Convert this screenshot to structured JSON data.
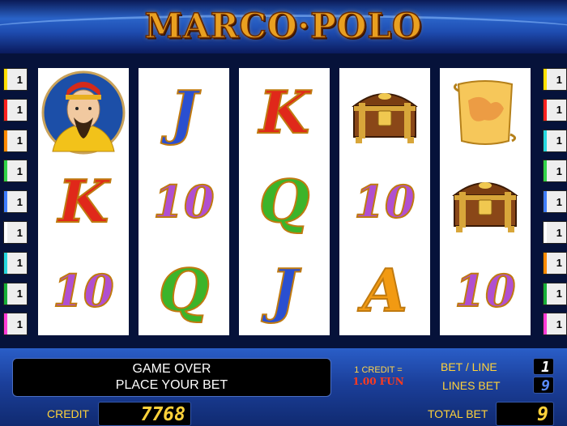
{
  "header": {
    "logo_text": "MARCO·POLO"
  },
  "left_lines": [
    {
      "label": "1",
      "color": "#ffe000"
    },
    {
      "label": "1",
      "color": "#ff2020"
    },
    {
      "label": "1",
      "color": "#ff8a00"
    },
    {
      "label": "1",
      "color": "#31d44a"
    },
    {
      "label": "1",
      "color": "#3f7dff"
    },
    {
      "label": "1",
      "color": "#ffffff"
    },
    {
      "label": "1",
      "color": "#26d7e0"
    },
    {
      "label": "1",
      "color": "#16b03a"
    },
    {
      "label": "1",
      "color": "#ff3bd8"
    }
  ],
  "right_lines": [
    {
      "label": "1",
      "color": "#ffe000"
    },
    {
      "label": "1",
      "color": "#ff2020"
    },
    {
      "label": "1",
      "color": "#26d7e0"
    },
    {
      "label": "1",
      "color": "#31d44a"
    },
    {
      "label": "1",
      "color": "#3f7dff"
    },
    {
      "label": "1",
      "color": "#ffffff"
    },
    {
      "label": "1",
      "color": "#ff8a00"
    },
    {
      "label": "1",
      "color": "#16b03a"
    },
    {
      "label": "1",
      "color": "#ff3bd8"
    }
  ],
  "reels": [
    [
      "marco-polo",
      "K",
      "10"
    ],
    [
      "J",
      "10",
      "Q"
    ],
    [
      "K",
      "Q",
      "J"
    ],
    [
      "chest",
      "10",
      "A"
    ],
    [
      "map",
      "chest",
      "10"
    ]
  ],
  "panel": {
    "message_line1": "GAME OVER",
    "message_line2": "PLACE YOUR BET",
    "rate_line1": "1 CREDIT =",
    "rate_line2": "1.00 FUN",
    "bet_line_label": "BET / LINE",
    "bet_line_value": "1",
    "lines_bet_label": "LINES BET",
    "lines_bet_value": "9",
    "credit_label": "CREDIT",
    "credit_value": "7768",
    "total_bet_label": "TOTAL BET",
    "total_bet_value": "9"
  },
  "colors": {
    "letter_K": "#e0281a",
    "letter_J": "#2a4fd0",
    "letter_Q": "#3cb42a",
    "letter_10": "#b04fd0",
    "letter_A": "#f29a12"
  }
}
